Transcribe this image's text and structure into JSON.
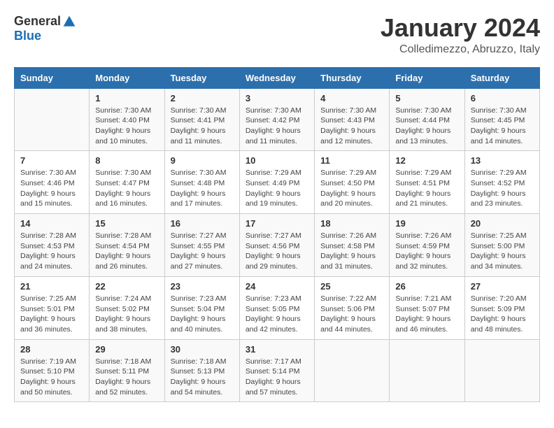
{
  "header": {
    "logo_general": "General",
    "logo_blue": "Blue",
    "month_year": "January 2024",
    "location": "Colledimezzo, Abruzzo, Italy"
  },
  "weekdays": [
    "Sunday",
    "Monday",
    "Tuesday",
    "Wednesday",
    "Thursday",
    "Friday",
    "Saturday"
  ],
  "weeks": [
    [
      {
        "day": "",
        "info": ""
      },
      {
        "day": "1",
        "info": "Sunrise: 7:30 AM\nSunset: 4:40 PM\nDaylight: 9 hours\nand 10 minutes."
      },
      {
        "day": "2",
        "info": "Sunrise: 7:30 AM\nSunset: 4:41 PM\nDaylight: 9 hours\nand 11 minutes."
      },
      {
        "day": "3",
        "info": "Sunrise: 7:30 AM\nSunset: 4:42 PM\nDaylight: 9 hours\nand 11 minutes."
      },
      {
        "day": "4",
        "info": "Sunrise: 7:30 AM\nSunset: 4:43 PM\nDaylight: 9 hours\nand 12 minutes."
      },
      {
        "day": "5",
        "info": "Sunrise: 7:30 AM\nSunset: 4:44 PM\nDaylight: 9 hours\nand 13 minutes."
      },
      {
        "day": "6",
        "info": "Sunrise: 7:30 AM\nSunset: 4:45 PM\nDaylight: 9 hours\nand 14 minutes."
      }
    ],
    [
      {
        "day": "7",
        "info": "Sunrise: 7:30 AM\nSunset: 4:46 PM\nDaylight: 9 hours\nand 15 minutes."
      },
      {
        "day": "8",
        "info": "Sunrise: 7:30 AM\nSunset: 4:47 PM\nDaylight: 9 hours\nand 16 minutes."
      },
      {
        "day": "9",
        "info": "Sunrise: 7:30 AM\nSunset: 4:48 PM\nDaylight: 9 hours\nand 17 minutes."
      },
      {
        "day": "10",
        "info": "Sunrise: 7:29 AM\nSunset: 4:49 PM\nDaylight: 9 hours\nand 19 minutes."
      },
      {
        "day": "11",
        "info": "Sunrise: 7:29 AM\nSunset: 4:50 PM\nDaylight: 9 hours\nand 20 minutes."
      },
      {
        "day": "12",
        "info": "Sunrise: 7:29 AM\nSunset: 4:51 PM\nDaylight: 9 hours\nand 21 minutes."
      },
      {
        "day": "13",
        "info": "Sunrise: 7:29 AM\nSunset: 4:52 PM\nDaylight: 9 hours\nand 23 minutes."
      }
    ],
    [
      {
        "day": "14",
        "info": "Sunrise: 7:28 AM\nSunset: 4:53 PM\nDaylight: 9 hours\nand 24 minutes."
      },
      {
        "day": "15",
        "info": "Sunrise: 7:28 AM\nSunset: 4:54 PM\nDaylight: 9 hours\nand 26 minutes."
      },
      {
        "day": "16",
        "info": "Sunrise: 7:27 AM\nSunset: 4:55 PM\nDaylight: 9 hours\nand 27 minutes."
      },
      {
        "day": "17",
        "info": "Sunrise: 7:27 AM\nSunset: 4:56 PM\nDaylight: 9 hours\nand 29 minutes."
      },
      {
        "day": "18",
        "info": "Sunrise: 7:26 AM\nSunset: 4:58 PM\nDaylight: 9 hours\nand 31 minutes."
      },
      {
        "day": "19",
        "info": "Sunrise: 7:26 AM\nSunset: 4:59 PM\nDaylight: 9 hours\nand 32 minutes."
      },
      {
        "day": "20",
        "info": "Sunrise: 7:25 AM\nSunset: 5:00 PM\nDaylight: 9 hours\nand 34 minutes."
      }
    ],
    [
      {
        "day": "21",
        "info": "Sunrise: 7:25 AM\nSunset: 5:01 PM\nDaylight: 9 hours\nand 36 minutes."
      },
      {
        "day": "22",
        "info": "Sunrise: 7:24 AM\nSunset: 5:02 PM\nDaylight: 9 hours\nand 38 minutes."
      },
      {
        "day": "23",
        "info": "Sunrise: 7:23 AM\nSunset: 5:04 PM\nDaylight: 9 hours\nand 40 minutes."
      },
      {
        "day": "24",
        "info": "Sunrise: 7:23 AM\nSunset: 5:05 PM\nDaylight: 9 hours\nand 42 minutes."
      },
      {
        "day": "25",
        "info": "Sunrise: 7:22 AM\nSunset: 5:06 PM\nDaylight: 9 hours\nand 44 minutes."
      },
      {
        "day": "26",
        "info": "Sunrise: 7:21 AM\nSunset: 5:07 PM\nDaylight: 9 hours\nand 46 minutes."
      },
      {
        "day": "27",
        "info": "Sunrise: 7:20 AM\nSunset: 5:09 PM\nDaylight: 9 hours\nand 48 minutes."
      }
    ],
    [
      {
        "day": "28",
        "info": "Sunrise: 7:19 AM\nSunset: 5:10 PM\nDaylight: 9 hours\nand 50 minutes."
      },
      {
        "day": "29",
        "info": "Sunrise: 7:18 AM\nSunset: 5:11 PM\nDaylight: 9 hours\nand 52 minutes."
      },
      {
        "day": "30",
        "info": "Sunrise: 7:18 AM\nSunset: 5:13 PM\nDaylight: 9 hours\nand 54 minutes."
      },
      {
        "day": "31",
        "info": "Sunrise: 7:17 AM\nSunset: 5:14 PM\nDaylight: 9 hours\nand 57 minutes."
      },
      {
        "day": "",
        "info": ""
      },
      {
        "day": "",
        "info": ""
      },
      {
        "day": "",
        "info": ""
      }
    ]
  ]
}
